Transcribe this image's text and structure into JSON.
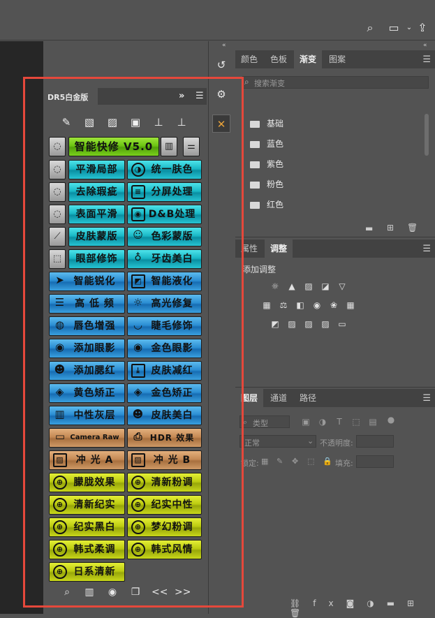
{
  "dr5_panel": {
    "tab_title": "DR5白金版",
    "expand_label": "»",
    "menu_label": "☰",
    "main_button": "智能快修 V5.0",
    "buttons": [
      [
        "平滑局部",
        "统一肤色"
      ],
      [
        "去除瑕疵",
        "分屏处理"
      ],
      [
        "表面平滑",
        "D&B处理"
      ],
      [
        "皮肤蒙版",
        "色彩蒙版"
      ],
      [
        "眼部修饰",
        "牙齿美白"
      ],
      [
        "智能锐化",
        "智能液化"
      ],
      [
        "高 低 频",
        "高光修复"
      ],
      [
        "唇色增强",
        "睫毛修饰"
      ],
      [
        "添加眼影",
        "金色眼影"
      ],
      [
        "添加腮红",
        "皮肤减红"
      ],
      [
        "黄色矫正",
        "金色矫正"
      ],
      [
        "中性灰层",
        "皮肤美白"
      ],
      [
        "Camera Raw",
        "HDR 效果"
      ],
      [
        "冲 光 A",
        "冲 光 B"
      ],
      [
        "朦胧效果",
        "清新粉调"
      ],
      [
        "清新纪实",
        "纪实中性"
      ],
      [
        "纪实黑白",
        "梦幻粉调"
      ],
      [
        "韩式柔调",
        "韩式风情"
      ],
      [
        "日系清新",
        ""
      ]
    ],
    "footer": {
      "prev": "<<",
      "next": ">>"
    }
  },
  "gradient_panel": {
    "tabs": [
      "颜色",
      "色板",
      "渐变",
      "图案"
    ],
    "active_tab": "渐变",
    "search_placeholder": "搜索渐变",
    "folders": [
      "基础",
      "蓝色",
      "紫色",
      "粉色",
      "红色"
    ]
  },
  "adjust_panel": {
    "tabs": [
      "属性",
      "调整"
    ],
    "active_tab": "调整",
    "heading": "添加调整"
  },
  "layers_panel": {
    "tabs": [
      "图层",
      "通道",
      "路径"
    ],
    "active_tab": "图层",
    "filter_label": "类型",
    "blend_mode": "正常",
    "opacity_label": "不透明度:",
    "lock_label": "锁定:",
    "fill_label": "填充:"
  },
  "colors": {
    "highlight_frame": "#e5483b"
  }
}
